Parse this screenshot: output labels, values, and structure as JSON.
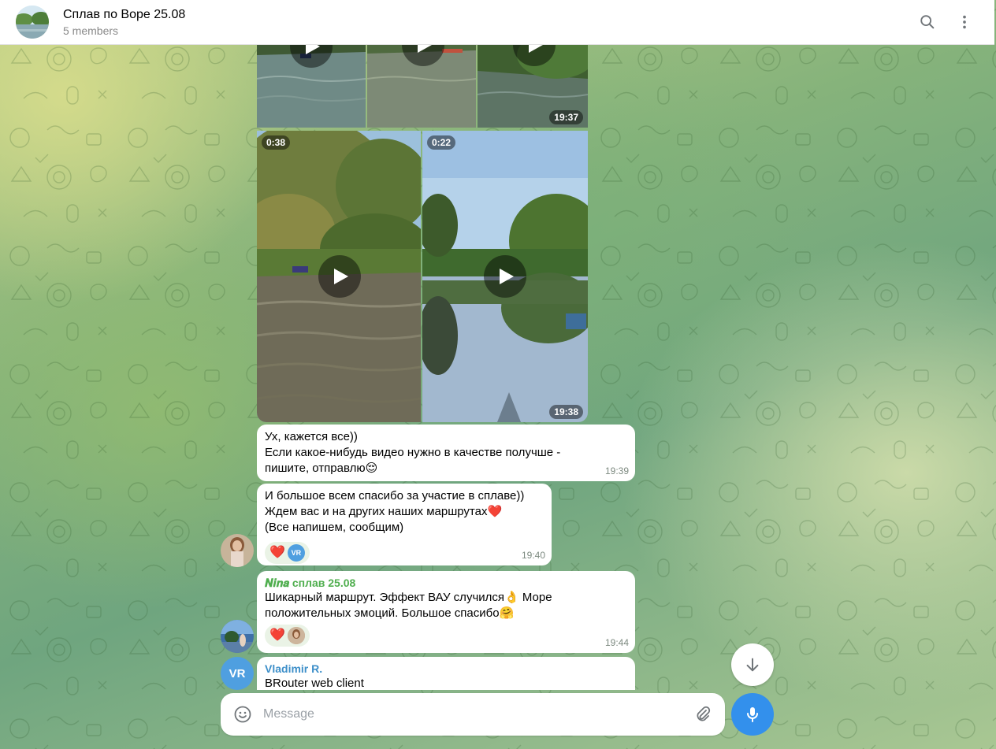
{
  "header": {
    "title": "Сплав по Воре 25.08",
    "subtitle": "5 members"
  },
  "album": {
    "row1_timestamp": "19:37",
    "row2_left_duration": "0:38",
    "row2_right_duration": "0:22",
    "row2_timestamp": "19:38"
  },
  "messages": [
    {
      "lines": [
        "Ух, кажется все))",
        "Если какое-нибудь видео нужно в качестве получше -",
        "пишите, отправлю😌"
      ],
      "time": "19:39"
    },
    {
      "lines": [
        "И большое всем спасибо за участие в сплаве))",
        "Ждем вас и на других наших маршрутах❤️",
        "(Все напишем, сообщим)"
      ],
      "reactions": [
        {
          "emoji": "❤️",
          "avatar_initials": "VR"
        }
      ],
      "time": "19:40"
    },
    {
      "sender": "𝑵𝒊𝒏𝒂 сплав 25.08",
      "lines": [
        "Шикарный маршрут. Эффект ВАУ случился👌 Море",
        "положительных эмоций. Большое спасибо🤗"
      ],
      "reactions": [
        {
          "emoji": "❤️"
        }
      ],
      "time": "19:44"
    },
    {
      "sender": "Vladimir R.",
      "avatar_initials": "VR",
      "lines": [
        "BRouter web client"
      ]
    }
  ],
  "composer": {
    "placeholder": "Message"
  },
  "colors": {
    "accent": "#3390ec",
    "nina_name": "#4fae4e",
    "vladimir_name": "#3d8fc9",
    "vr_avatar": "#4f9fe0"
  },
  "icons": [
    "search-icon",
    "more-vertical-icon",
    "emoji-icon",
    "attach-icon",
    "microphone-icon",
    "arrow-down-icon",
    "play-icon"
  ]
}
